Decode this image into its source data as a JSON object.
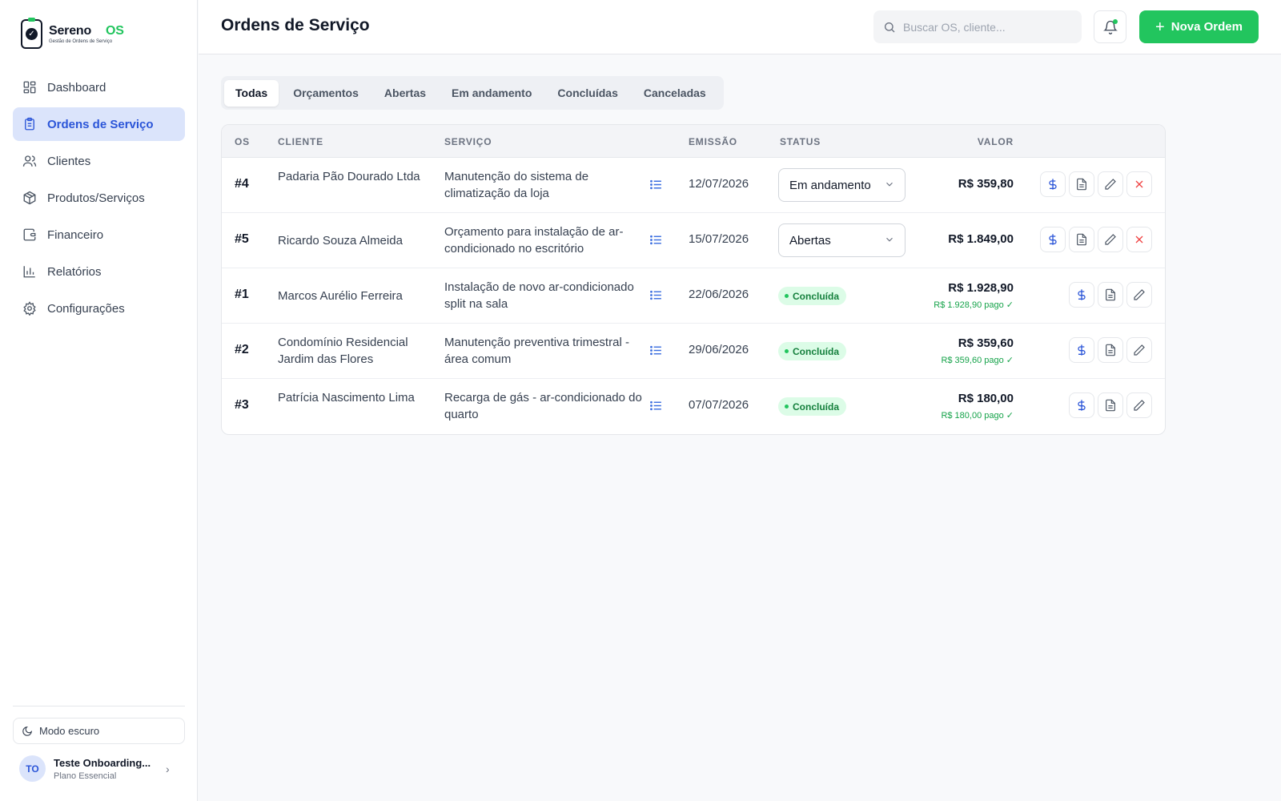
{
  "app": {
    "name": "Sereno",
    "name_suffix": "OS",
    "tagline": "Gestão de Ordens de Serviço"
  },
  "sidebar": {
    "items": [
      {
        "label": "Dashboard",
        "icon": "dashboard-icon"
      },
      {
        "label": "Ordens de Serviço",
        "icon": "clipboard-icon",
        "active": true
      },
      {
        "label": "Clientes",
        "icon": "users-icon"
      },
      {
        "label": "Produtos/Serviços",
        "icon": "box-icon"
      },
      {
        "label": "Financeiro",
        "icon": "wallet-icon"
      },
      {
        "label": "Relatórios",
        "icon": "chart-icon"
      },
      {
        "label": "Configurações",
        "icon": "gear-icon"
      }
    ],
    "dark_mode_label": "Modo escuro",
    "user": {
      "initials": "TO",
      "name": "Teste Onboarding...",
      "plan": "Plano Essencial"
    }
  },
  "header": {
    "title": "Ordens de Serviço",
    "search_placeholder": "Buscar OS, cliente...",
    "new_button_label": "Nova Ordem"
  },
  "tabs": [
    {
      "label": "Todas",
      "active": true
    },
    {
      "label": "Orçamentos"
    },
    {
      "label": "Abertas"
    },
    {
      "label": "Em andamento"
    },
    {
      "label": "Concluídas"
    },
    {
      "label": "Canceladas"
    }
  ],
  "table": {
    "columns": [
      "OS",
      "CLIENTE",
      "SERVIÇO",
      "EMISSÃO",
      "STATUS",
      "VALOR"
    ],
    "rows": [
      {
        "os": "#4",
        "client": "Padaria Pão Dourado Ltda",
        "service": "Manutenção do sistema de climatização da loja",
        "date": "12/07/2026",
        "status": "Em andamento",
        "status_type": "select",
        "value": "R$ 359,80",
        "paid": ""
      },
      {
        "os": "#5",
        "client": "Ricardo Souza Almeida",
        "service": "Orçamento para instalação de ar-condicionado no escritório",
        "date": "15/07/2026",
        "status": "Abertas",
        "status_type": "select",
        "value": "R$ 1.849,00",
        "paid": ""
      },
      {
        "os": "#1",
        "client": "Marcos Aurélio Ferreira",
        "service": "Instalação de novo ar-condicionado split na sala",
        "date": "22/06/2026",
        "status": "Concluída",
        "status_type": "badge",
        "value": "R$ 1.928,90",
        "paid": "R$ 1.928,90 pago ✓"
      },
      {
        "os": "#2",
        "client": "Condomínio Residencial Jardim das Flores",
        "service": "Manutenção preventiva trimestral - área comum",
        "date": "29/06/2026",
        "status": "Concluída",
        "status_type": "badge",
        "value": "R$ 359,60",
        "paid": "R$ 359,60 pago ✓"
      },
      {
        "os": "#3",
        "client": "Patrícia Nascimento Lima",
        "service": "Recarga de gás - ar-condicionado do quarto",
        "date": "07/07/2026",
        "status": "Concluída",
        "status_type": "badge",
        "value": "R$ 180,00",
        "paid": "R$ 180,00 pago ✓"
      }
    ]
  },
  "colors": {
    "accent_green": "#22c55e",
    "active_blue": "#2b55d8",
    "danger_red": "#ef4444"
  }
}
